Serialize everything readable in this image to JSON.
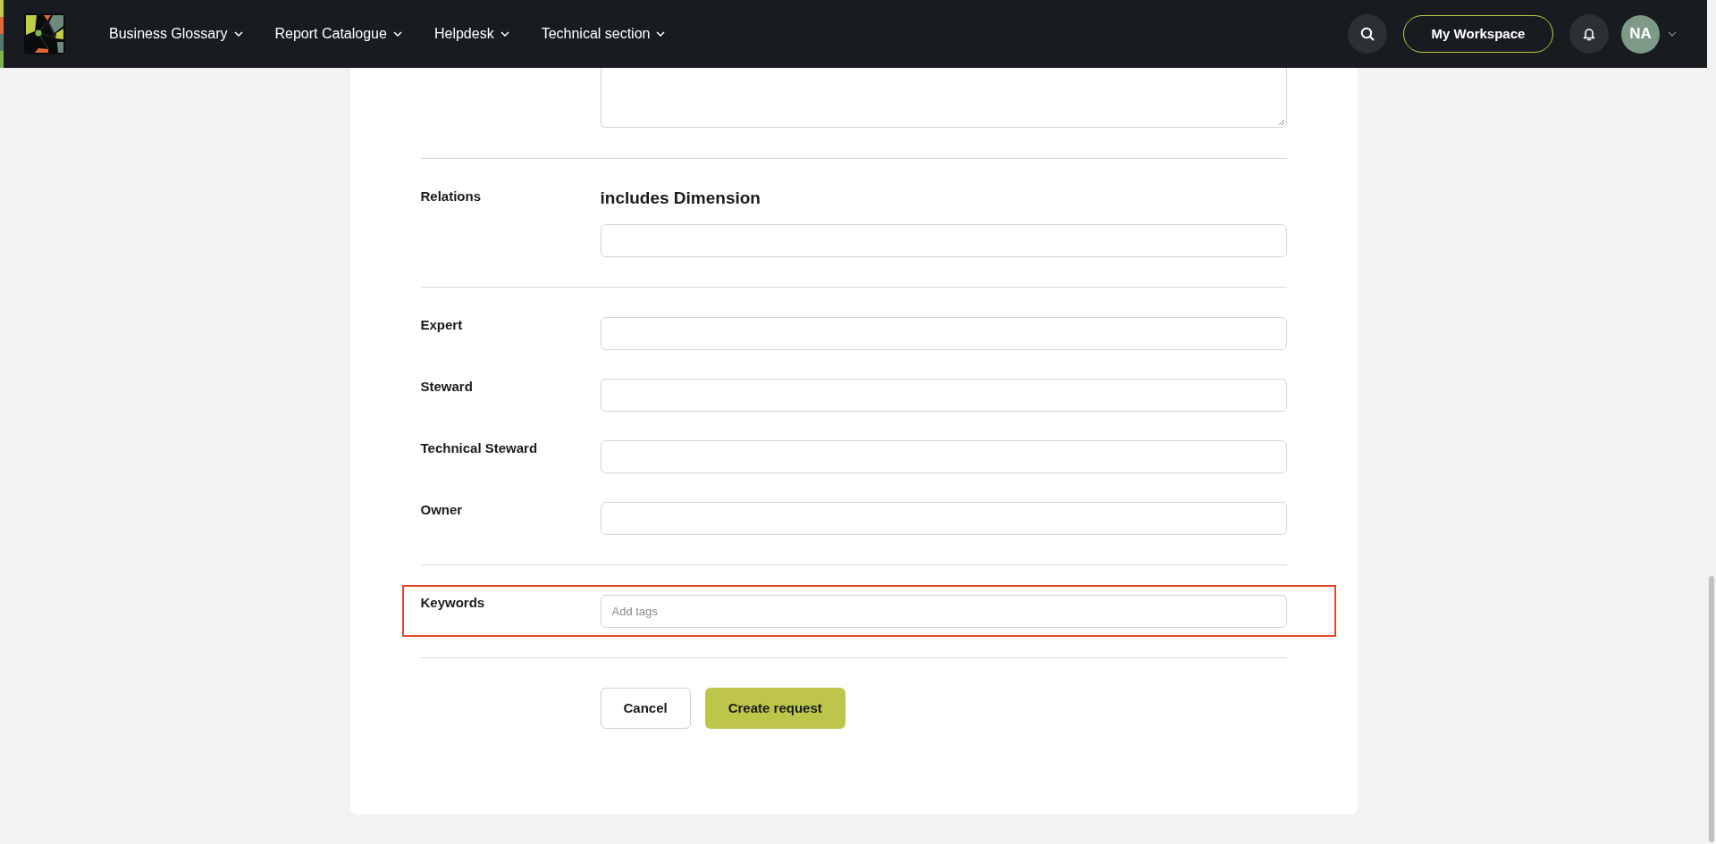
{
  "nav": {
    "menu": [
      {
        "label": "Business Glossary"
      },
      {
        "label": "Report Catalogue"
      },
      {
        "label": "Helpdesk"
      },
      {
        "label": "Technical section"
      }
    ],
    "workspace_button": "My Workspace",
    "avatar_initials": "NA"
  },
  "form": {
    "groups": [
      [
        {
          "kind": "textarea",
          "highlighted": false
        }
      ],
      [
        {
          "kind": "relation",
          "label": "Relations",
          "heading": "includes Dimension",
          "highlighted": false
        }
      ],
      [
        {
          "kind": "input",
          "label": "Expert",
          "highlighted": false
        },
        {
          "kind": "input",
          "label": "Steward",
          "highlighted": false
        },
        {
          "kind": "input",
          "label": "Technical Steward",
          "highlighted": false
        },
        {
          "kind": "input",
          "label": "Owner",
          "highlighted": false
        }
      ],
      [
        {
          "kind": "tags",
          "label": "Keywords",
          "placeholder": "Add tags",
          "highlighted": true
        }
      ]
    ],
    "buttons": [
      {
        "kind": "secondary",
        "label": "Cancel"
      },
      {
        "kind": "primary",
        "label": "Create request"
      }
    ]
  }
}
